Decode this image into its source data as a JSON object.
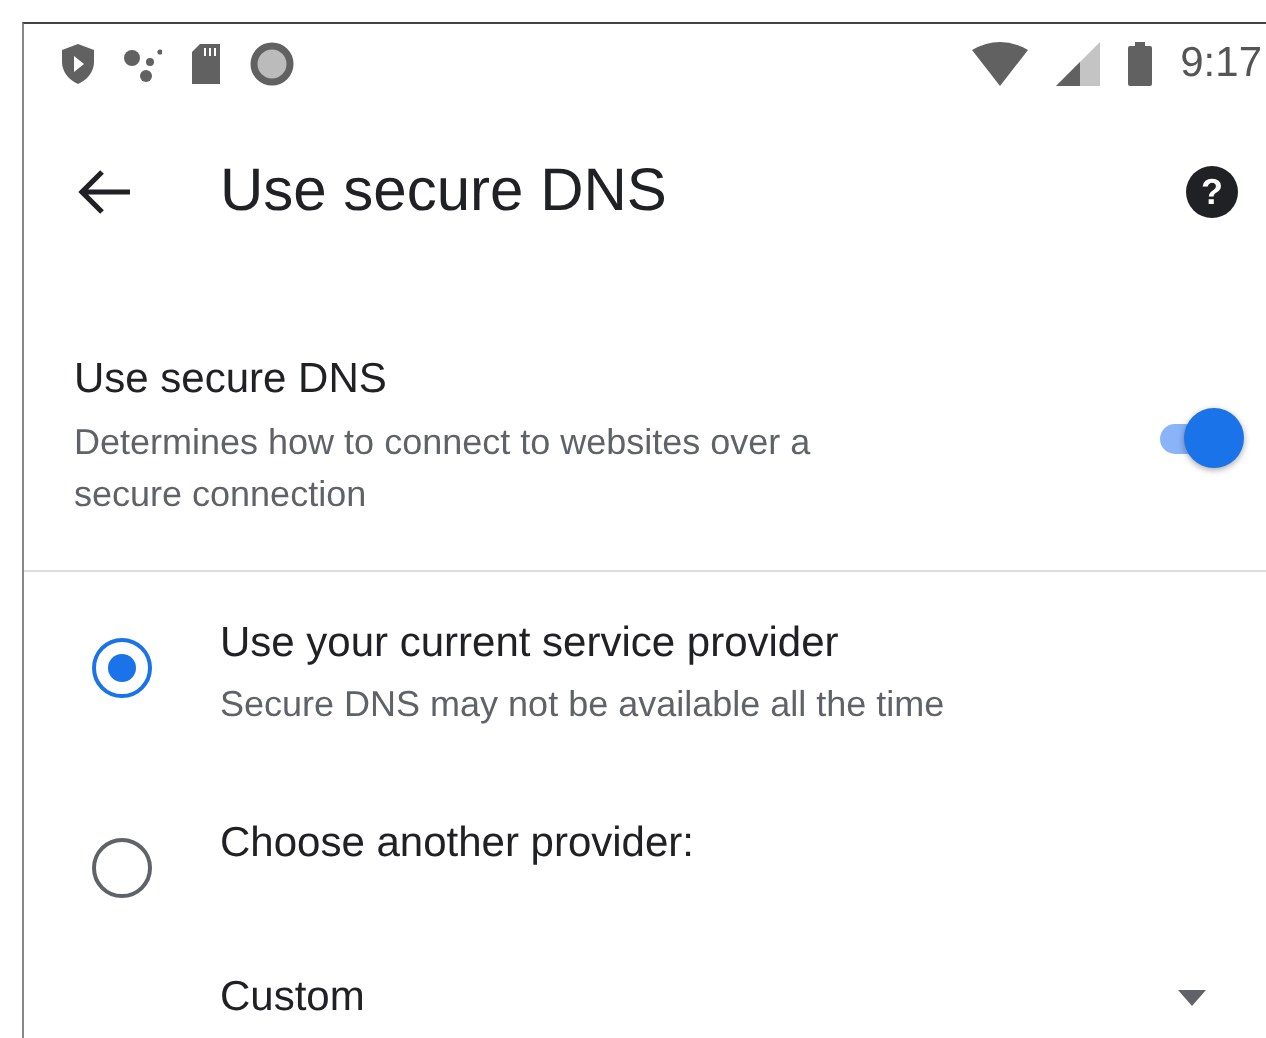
{
  "status_bar": {
    "time": "9:17"
  },
  "toolbar": {
    "title": "Use secure DNS",
    "help": "?"
  },
  "setting": {
    "title": "Use secure DNS",
    "summary": "Determines how to connect to websites over a secure connection",
    "on": true
  },
  "options": [
    {
      "label": "Use your current service provider",
      "description": "Secure DNS may not be available all the time",
      "selected": true
    },
    {
      "label": "Choose another provider:",
      "selected": false
    }
  ],
  "provider_dropdown": {
    "value": "Custom"
  }
}
